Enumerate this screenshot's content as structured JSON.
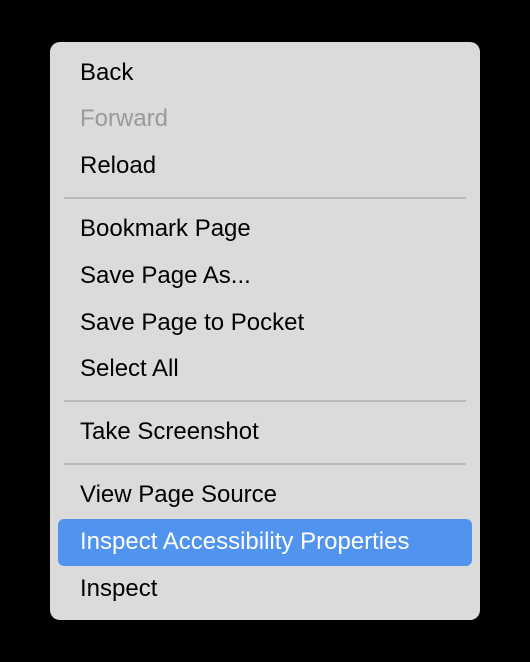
{
  "menu": {
    "items": [
      {
        "label": "Back",
        "kind": "item",
        "disabled": false,
        "highlighted": false
      },
      {
        "label": "Forward",
        "kind": "item",
        "disabled": true,
        "highlighted": false
      },
      {
        "label": "Reload",
        "kind": "item",
        "disabled": false,
        "highlighted": false
      },
      {
        "label": "",
        "kind": "separator"
      },
      {
        "label": "Bookmark Page",
        "kind": "item",
        "disabled": false,
        "highlighted": false
      },
      {
        "label": "Save Page As...",
        "kind": "item",
        "disabled": false,
        "highlighted": false
      },
      {
        "label": "Save Page to Pocket",
        "kind": "item",
        "disabled": false,
        "highlighted": false
      },
      {
        "label": "Select All",
        "kind": "item",
        "disabled": false,
        "highlighted": false
      },
      {
        "label": "",
        "kind": "separator"
      },
      {
        "label": "Take Screenshot",
        "kind": "item",
        "disabled": false,
        "highlighted": false
      },
      {
        "label": "",
        "kind": "separator"
      },
      {
        "label": "View Page Source",
        "kind": "item",
        "disabled": false,
        "highlighted": false
      },
      {
        "label": "Inspect Accessibility Properties",
        "kind": "item",
        "disabled": false,
        "highlighted": true
      },
      {
        "label": "Inspect",
        "kind": "item",
        "disabled": false,
        "highlighted": false
      }
    ]
  }
}
